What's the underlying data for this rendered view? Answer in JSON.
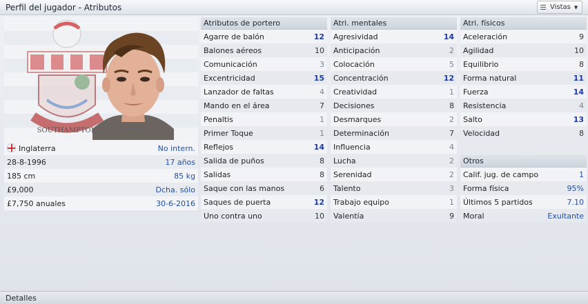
{
  "window": {
    "title": "Perfil del jugador - Atributos",
    "views_label": "Vistas",
    "footer": "Detalles"
  },
  "profile": {
    "nationality": "Inglaterra",
    "international": "No intern.",
    "birthdate": "28-8-1996",
    "age": "17 años",
    "height": "185 cm",
    "weight": "85 kg",
    "value": "£9,000",
    "foot": "Dcha. sólo",
    "wage": "£7,750 anuales",
    "contract_end": "30-6-2016",
    "crest_text": "SOUTHAMPTON"
  },
  "goalkeeping": {
    "title": "Atributos de portero",
    "rows": [
      {
        "label": "Agarre de balón",
        "value": "12"
      },
      {
        "label": "Balones aéreos",
        "value": "10"
      },
      {
        "label": "Comunicación",
        "value": "3"
      },
      {
        "label": "Excentricidad",
        "value": "15"
      },
      {
        "label": "Lanzador de faltas",
        "value": "4"
      },
      {
        "label": "Mando en el área",
        "value": "7"
      },
      {
        "label": "Penaltis",
        "value": "1"
      },
      {
        "label": "Primer Toque",
        "value": "1"
      },
      {
        "label": "Reflejos",
        "value": "14"
      },
      {
        "label": "Salida de puños",
        "value": "8"
      },
      {
        "label": "Salidas",
        "value": "8"
      },
      {
        "label": "Saque con las manos",
        "value": "6"
      },
      {
        "label": "Saques de puerta",
        "value": "12"
      },
      {
        "label": "Uno contra uno",
        "value": "10"
      }
    ]
  },
  "mental": {
    "title": "Atri. mentales",
    "rows": [
      {
        "label": "Agresividad",
        "value": "14"
      },
      {
        "label": "Anticipación",
        "value": "2"
      },
      {
        "label": "Colocación",
        "value": "5"
      },
      {
        "label": "Concentración",
        "value": "12"
      },
      {
        "label": "Creatividad",
        "value": "1"
      },
      {
        "label": "Decisiones",
        "value": "8"
      },
      {
        "label": "Desmarques",
        "value": "2"
      },
      {
        "label": "Determinación",
        "value": "7"
      },
      {
        "label": "Influencia",
        "value": "4"
      },
      {
        "label": "Lucha",
        "value": "2"
      },
      {
        "label": "Serenidad",
        "value": "2"
      },
      {
        "label": "Talento",
        "value": "3"
      },
      {
        "label": "Trabajo equipo",
        "value": "1"
      },
      {
        "label": "Valentía",
        "value": "9"
      }
    ]
  },
  "physical": {
    "title": "Atri. físicos",
    "rows": [
      {
        "label": "Aceleración",
        "value": "9"
      },
      {
        "label": "Agilidad",
        "value": "10"
      },
      {
        "label": "Equilibrio",
        "value": "8"
      },
      {
        "label": "Forma natural",
        "value": "11"
      },
      {
        "label": "Fuerza",
        "value": "14"
      },
      {
        "label": "Resistencia",
        "value": "4"
      },
      {
        "label": "Salto",
        "value": "13"
      },
      {
        "label": "Velocidad",
        "value": "8"
      }
    ]
  },
  "others": {
    "title": "Otros",
    "rows": [
      {
        "label": "Calif. jug. de campo",
        "value": "1"
      },
      {
        "label": "Forma física",
        "value": "95%"
      },
      {
        "label": "Últimos 5 partidos",
        "value": "7.10"
      },
      {
        "label": "Moral",
        "value": "Exultante"
      }
    ]
  },
  "colors": {
    "high_value": "#1d3aa8",
    "low_value": "#7d828b",
    "link_blue": "#1f4fa8"
  }
}
